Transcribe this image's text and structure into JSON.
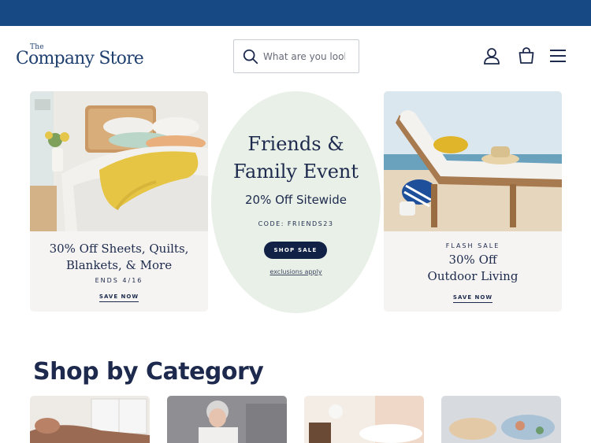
{
  "brand": {
    "logo_the": "The",
    "logo_name": "Company Store"
  },
  "search": {
    "placeholder": "What are you looking for?"
  },
  "icons": [
    "search-icon",
    "account-icon",
    "cart-icon",
    "menu-icon"
  ],
  "promo_left": {
    "line1": "30% Off Sheets, Quilts,",
    "line2": "Blankets, & More",
    "ends": "ENDS 4/16",
    "cta": "SAVE NOW"
  },
  "promo_center": {
    "title_line1": "Friends &",
    "title_line2": "Family Event",
    "subtitle": "20% Off Sitewide",
    "code": "CODE: FRIENDS23",
    "cta": "SHOP SALE",
    "exclusions": "exclusions apply"
  },
  "promo_right": {
    "eyebrow": "FLASH SALE",
    "line1": "30% Off",
    "line2": "Outdoor Living",
    "cta": "SAVE NOW"
  },
  "section": {
    "title": "Shop by Category"
  },
  "colors": {
    "topbar": "#174a84",
    "navy": "#1d2a4d",
    "oval": "#e9f0e8",
    "card": "#f5f4f2"
  }
}
